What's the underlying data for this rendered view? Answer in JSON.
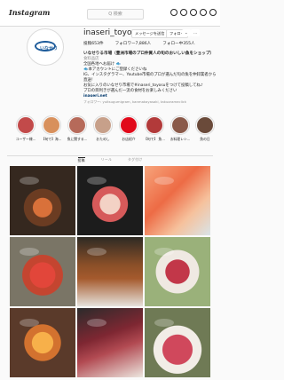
{
  "app": {
    "logo": "Instagram"
  },
  "search": {
    "placeholder": "Q 検索"
  },
  "nav_icons": [
    "home-icon",
    "messenger-icon",
    "explore-icon",
    "activity-icon",
    "profile-icon"
  ],
  "profile": {
    "avatar_text": "いなせり",
    "username": "inaseri_toyosu",
    "message_label": "メッセージを送信",
    "follow_label": "フォロー",
    "stats": {
      "posts": "投稿653件",
      "followers": "フォロワー7,886人",
      "following": "フォロー中355人"
    },
    "bio": {
      "name": "いなせりる市場（豊洲市場のプロ仲買人の旬のおいしい魚をショップ）",
      "category": "食料品店",
      "lines": [
        "全国各地へお届け 🐟",
        "🐟本アカウントにご登録くださいね",
        "IG、インスタグラマー、Youtube市場のプロが選んだ旬の魚を仲卸業者から直送！",
        "お気に入りのいなせり市場で#inaseri_toyosuをつけて投稿してね♪",
        "プロの目利きが選んだ一流の食材をお楽しみください"
      ],
      "link": "inaseri.net"
    },
    "followed_by": "フォロワー: yuitsugumigram, kanmakayasaki, takuorameclick"
  },
  "highlights": [
    {
      "label": "ユーザー様...",
      "color": "#c24a4a"
    },
    {
      "label": "【旬で】海...",
      "color": "#d8905c"
    },
    {
      "label": "魚に関する...",
      "color": "#b66a5a"
    },
    {
      "label": "おためし",
      "color": "#c7a08a"
    },
    {
      "label": "お店紹介",
      "color": "#e10a1b"
    },
    {
      "label": "【旬で】 魚...",
      "color": "#b23a3a"
    },
    {
      "label": "お料理レシ...",
      "color": "#8a5a4a"
    },
    {
      "label": "魚の日",
      "color": "#6a4a3a"
    }
  ],
  "tabs": [
    "投稿",
    "リール",
    "タグ付け"
  ]
}
